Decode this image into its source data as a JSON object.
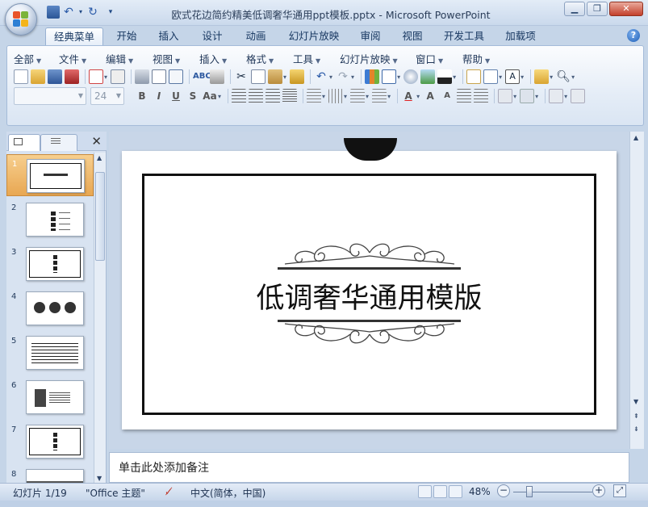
{
  "window": {
    "title": "欧式花边简约精美低调奢华通用ppt模板.pptx - Microsoft PowerPoint"
  },
  "tabs": [
    "经典菜单",
    "开始",
    "插入",
    "设计",
    "动画",
    "幻灯片放映",
    "审阅",
    "视图",
    "开发工具",
    "加载项"
  ],
  "menus": [
    "全部",
    "文件",
    "编辑",
    "视图",
    "插入",
    "格式",
    "工具",
    "幻灯片放映",
    "窗口",
    "帮助"
  ],
  "font": {
    "name": "",
    "size": "24"
  },
  "slides": [
    {
      "num": "1",
      "kind": "title"
    },
    {
      "num": "2",
      "kind": "list"
    },
    {
      "num": "3",
      "kind": "dots"
    },
    {
      "num": "4",
      "kind": "circles"
    },
    {
      "num": "5",
      "kind": "table"
    },
    {
      "num": "6",
      "kind": "image"
    },
    {
      "num": "7",
      "kind": "dots"
    },
    {
      "num": "8",
      "kind": "dark"
    }
  ],
  "slide": {
    "title": "低调奢华通用模版"
  },
  "notes": {
    "placeholder": "单击此处添加备注"
  },
  "status": {
    "slide": "幻灯片 1/19",
    "theme": "\"Office 主题\"",
    "language": "中文(简体，中国)",
    "zoom": "48%"
  }
}
